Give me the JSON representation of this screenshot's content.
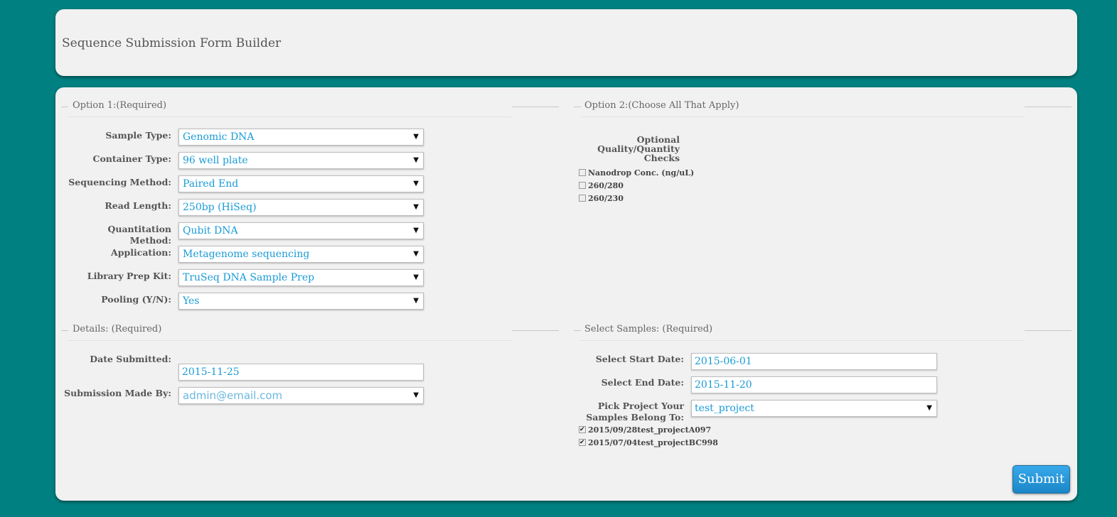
{
  "header": {
    "title": "Sequence Submission Form Builder"
  },
  "option1": {
    "legend": "Option 1:(Required)",
    "fields": [
      {
        "label": "Sample Type:",
        "value": "Genomic DNA"
      },
      {
        "label": "Container Type:",
        "value": "96 well plate"
      },
      {
        "label": "Sequencing Method:",
        "value": "Paired End"
      },
      {
        "label": "Read Length:",
        "value": "250bp (HiSeq)"
      },
      {
        "label": "Quantitation Method:",
        "value": "Qubit DNA"
      },
      {
        "label": "Application:",
        "value": "Metagenome sequencing"
      },
      {
        "label": "Library Prep Kit:",
        "value": "TruSeq DNA Sample Prep"
      },
      {
        "label": "Pooling (Y/N):",
        "value": "Yes"
      }
    ]
  },
  "option2": {
    "legend": "Option 2:(Choose All That Apply)",
    "heading_lines": [
      "Optional",
      "Quality/Quantity",
      "Checks"
    ],
    "checks": [
      {
        "label": "Nanodrop Conc. (ng/uL)",
        "checked": false
      },
      {
        "label": "260/280",
        "checked": false
      },
      {
        "label": "260/230",
        "checked": false
      }
    ]
  },
  "details": {
    "legend": "Details: (Required)",
    "date_label": "Date Submitted:",
    "date_value": "2015-11-25",
    "made_by_label": "Submission Made By:",
    "made_by_value": "admin@email.com"
  },
  "samples": {
    "legend": "Select Samples: (Required)",
    "start_label": "Select Start Date:",
    "start_value": "2015-06-01",
    "end_label": "Select End Date:",
    "end_value": "2015-11-20",
    "project_label_lines": [
      "Pick Project Your",
      "Samples Belong To:"
    ],
    "project_value": "test_project",
    "items": [
      {
        "label": "2015/09/28test_projectA097",
        "checked": true
      },
      {
        "label": "2015/07/04test_projectBC998",
        "checked": true
      }
    ]
  },
  "submit_label": "Submit",
  "icons": {
    "dropdown": "▼"
  },
  "colors": {
    "background": "#008080",
    "value_text": "#1a9bd7",
    "submit": "#2a9de0"
  }
}
